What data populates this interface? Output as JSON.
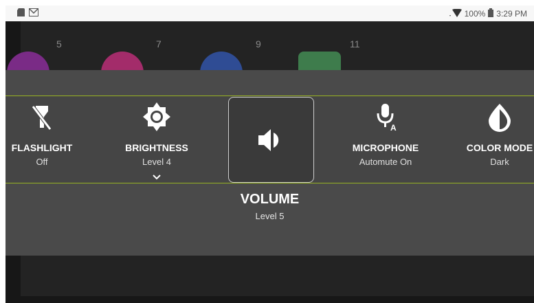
{
  "status_bar": {
    "battery": "100%",
    "time": "3:29 PM"
  },
  "home": {
    "page_numbers": [
      "5",
      "7",
      "9",
      "11"
    ],
    "app_icon_colors": [
      "#7a2b86",
      "#a32c6a",
      "#2f4c94",
      "#3e7c4c"
    ]
  },
  "quick_panel": {
    "tiles": [
      {
        "label": "FLASHLIGHT",
        "value": "Off",
        "icon": "flashlight-off-icon"
      },
      {
        "label": "BRIGHTNESS",
        "value": "Level 4",
        "icon": "brightness-icon"
      },
      {
        "label": "MICROPHONE",
        "value": "Automute On",
        "icon": "microphone-auto-icon"
      },
      {
        "label": "COLOR MODE",
        "value": "Dark",
        "icon": "color-mode-icon"
      }
    ],
    "selected": {
      "label": "VOLUME",
      "value": "Level 5",
      "icon": "volume-icon"
    },
    "accent_color": "#98b322"
  }
}
